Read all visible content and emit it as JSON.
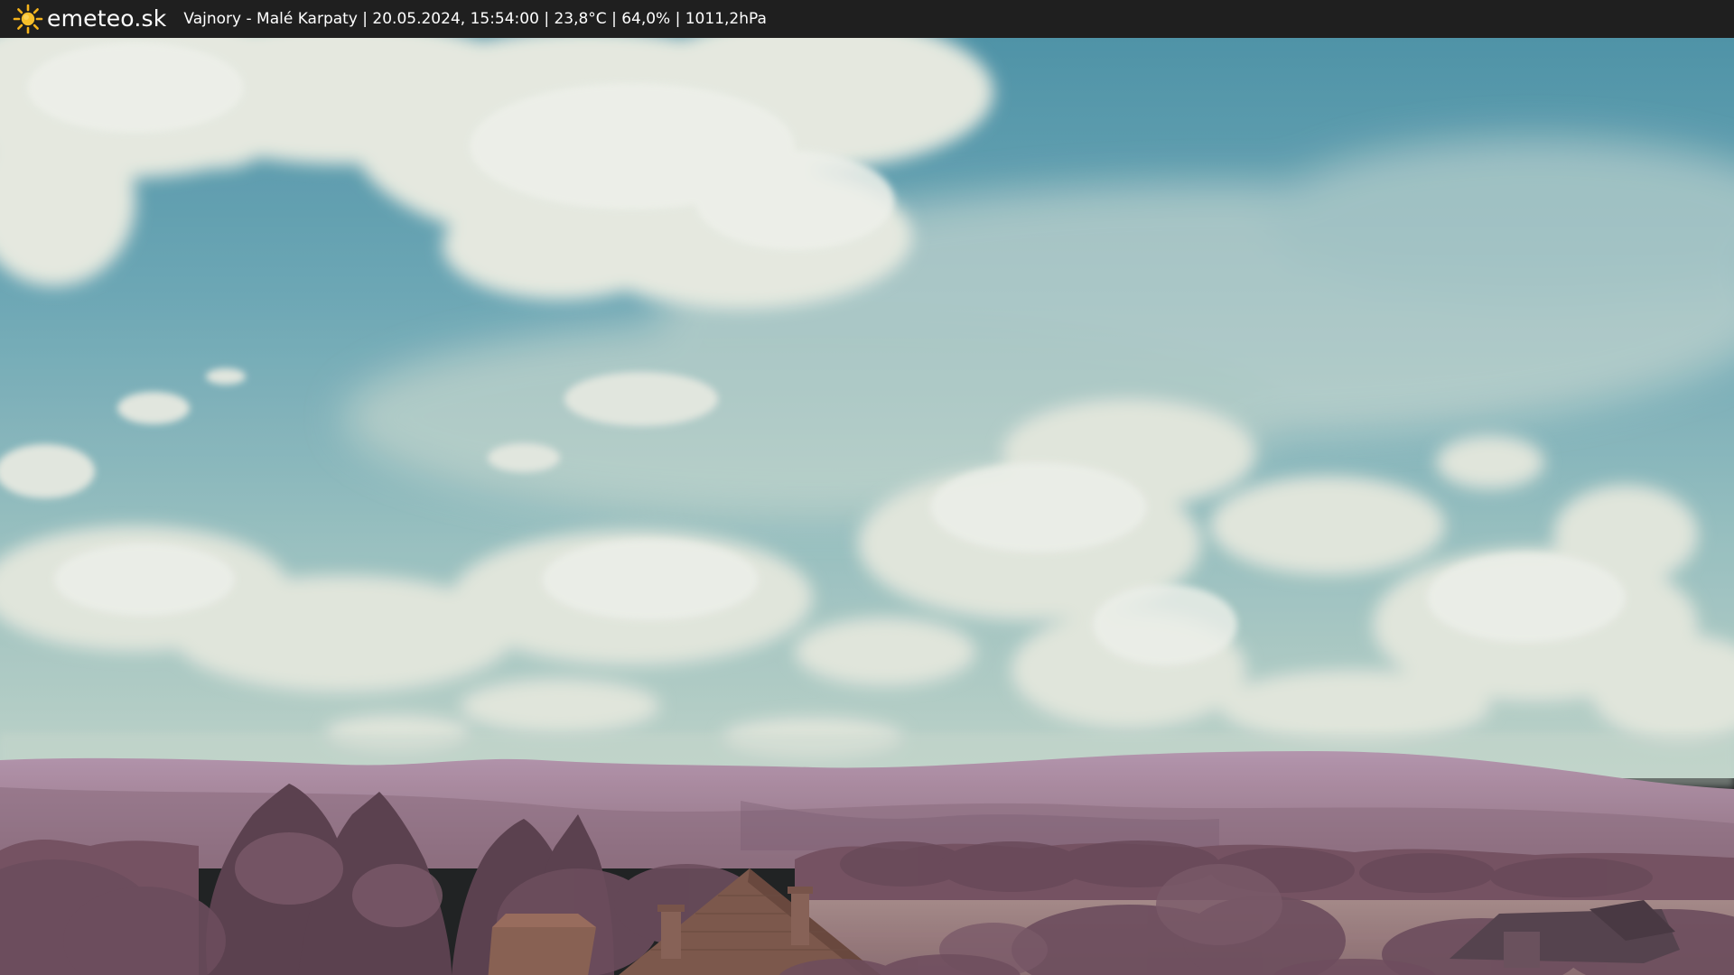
{
  "header": {
    "brand": "emeteo.sk",
    "station_info": "Vajnory - Malé Karpaty | 20.05.2024, 15:54:00 | 23,8°C | 64,0% | 1011,2hPa",
    "logo_icon": "sun-icon",
    "accent_color": "#f5b31b",
    "background_color": "#1f1f1f"
  },
  "scene": {
    "content": "webcam-image",
    "palette": {
      "sky_top": "#4f94a8",
      "sky_mid": "#78b0ba",
      "sky_horizon": "#b8d0c6",
      "cloud": "#e9ebdf",
      "hills": "#a77e98",
      "trees": "#6e4b5d",
      "field": "#9a7a7c",
      "roof": "#8a5a4c"
    }
  }
}
